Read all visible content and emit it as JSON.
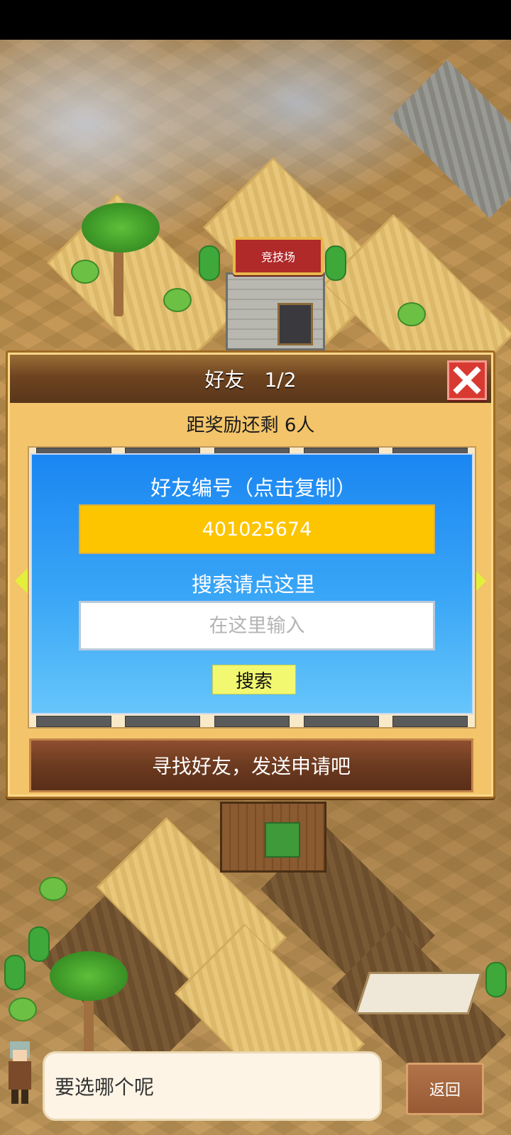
{
  "map": {
    "arena_sign": "竞技场"
  },
  "dialog": {
    "title": "好友　1/2",
    "reward_text": "距奖励还剩 6人",
    "id_label": "好友编号（点击复制）",
    "friend_id": "401025674",
    "search_label": "搜索请点这里",
    "search_placeholder": "在这里输入",
    "search_button": "搜索",
    "find_button": "寻找好友，发送申请吧",
    "close_icon": "close-x-icon",
    "nav_icons": [
      "arrow-left-icon",
      "arrow-right-icon"
    ]
  },
  "bottom": {
    "speech_text": "要选哪个呢",
    "back_button": "返回"
  },
  "colors": {
    "panel_blue": "#1a86f2",
    "id_box_yellow": "#fdc400",
    "search_button": "#f2f870",
    "close_red": "#d83a32",
    "header_brown": "#6e4420",
    "dialog_tan": "#f3c46a"
  }
}
